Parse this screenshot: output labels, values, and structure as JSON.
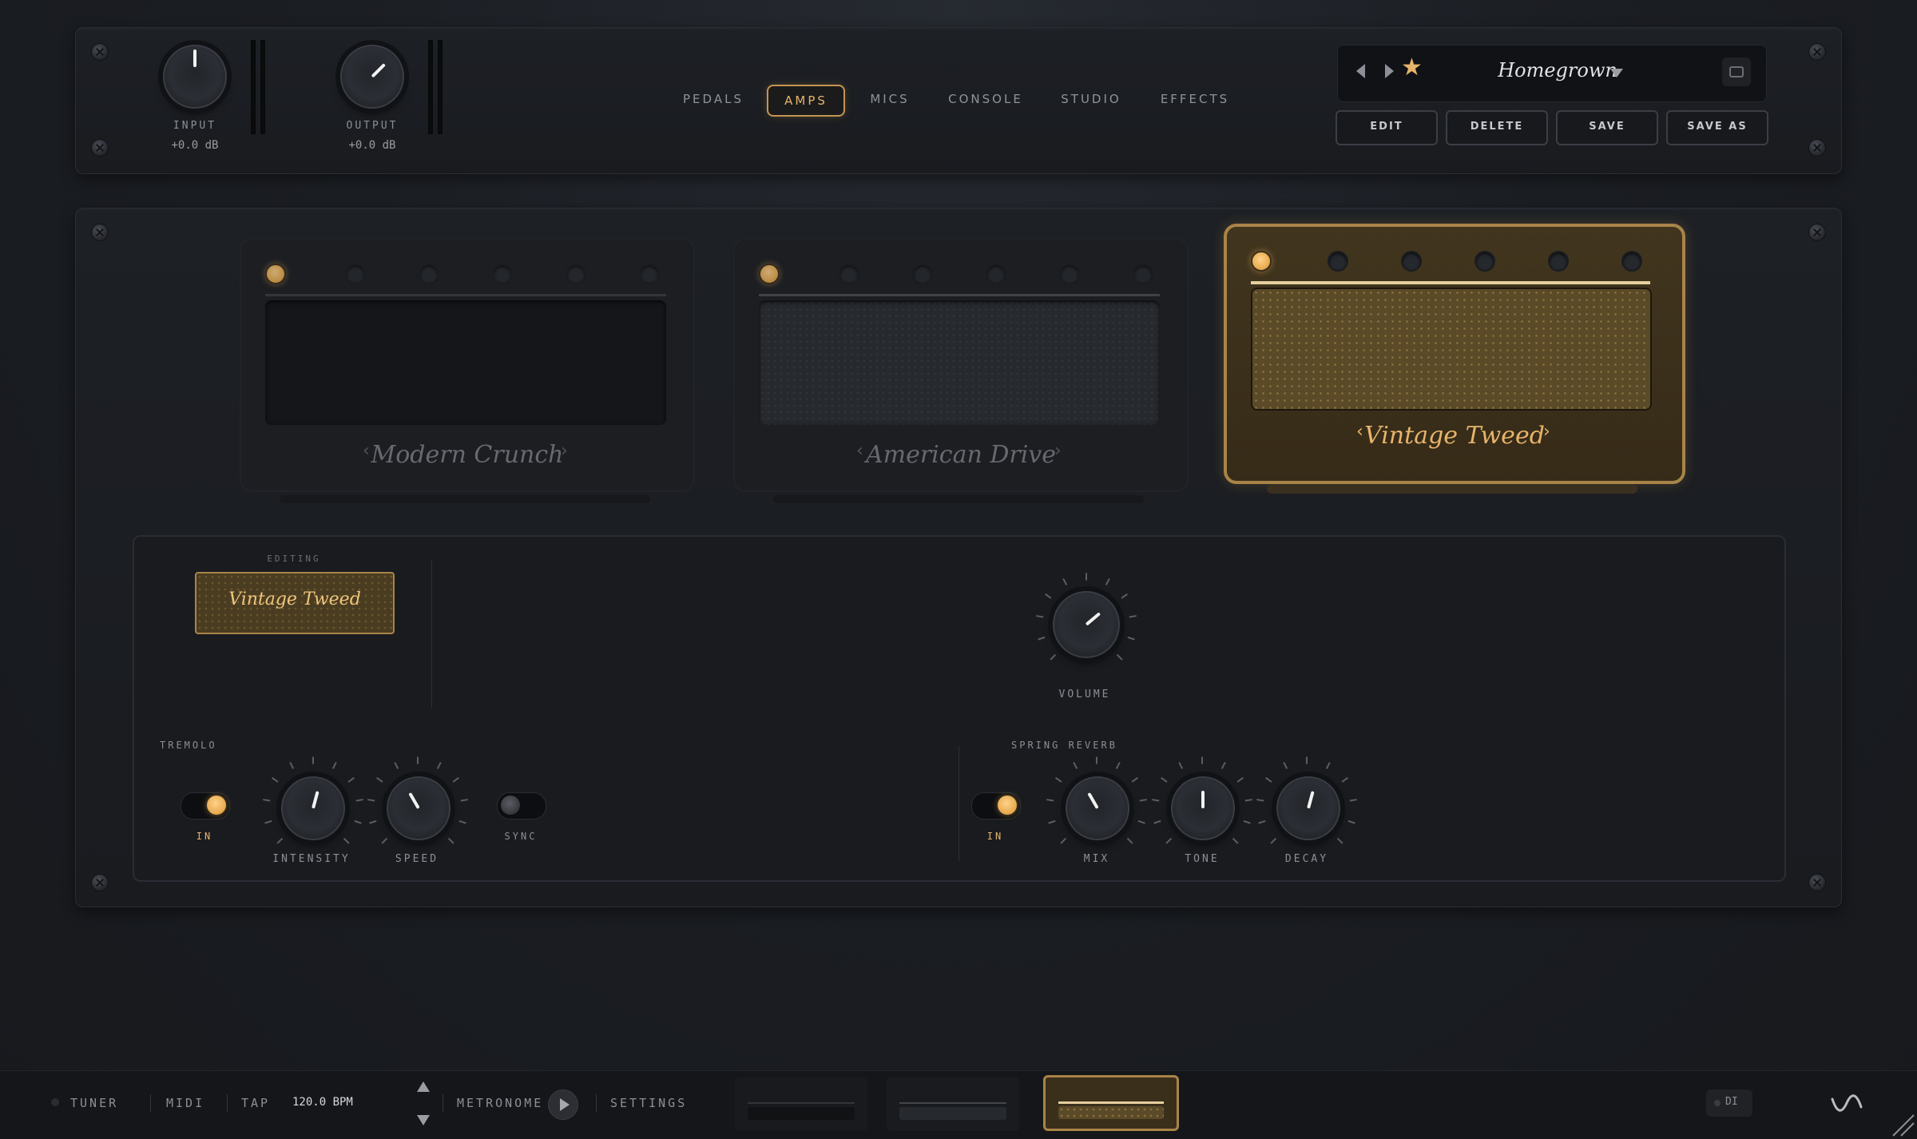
{
  "header": {
    "input": {
      "label": "INPUT",
      "value": "+0.0 dB"
    },
    "output": {
      "label": "OUTPUT",
      "value": "+0.0 dB"
    },
    "tabs": [
      {
        "label": "PEDALS",
        "active": false
      },
      {
        "label": "AMPS",
        "active": true
      },
      {
        "label": "MICS",
        "active": false
      },
      {
        "label": "CONSOLE",
        "active": false
      },
      {
        "label": "STUDIO",
        "active": false
      },
      {
        "label": "EFFECTS",
        "active": false
      }
    ],
    "preset": {
      "name": "Homegrown",
      "favorite": true
    },
    "buttons": {
      "edit": "EDIT",
      "delete": "DELETE",
      "save": "SAVE",
      "save_as": "SAVE AS"
    }
  },
  "amps": [
    {
      "name": "Modern Crunch",
      "selected": false
    },
    {
      "name": "American Drive",
      "selected": false
    },
    {
      "name": "Vintage Tweed",
      "selected": true
    }
  ],
  "editor": {
    "editing_label": "EDITING",
    "editing_name": "Vintage Tweed",
    "volume": {
      "label": "VOLUME"
    },
    "tremolo": {
      "title": "TREMOLO",
      "in_label": "IN",
      "in_on": true,
      "intensity": {
        "label": "INTENSITY"
      },
      "speed": {
        "label": "SPEED"
      },
      "sync_label": "SYNC",
      "sync_on": false
    },
    "spring_reverb": {
      "title": "SPRING REVERB",
      "in_label": "IN",
      "in_on": true,
      "mix": {
        "label": "MIX"
      },
      "tone": {
        "label": "TONE"
      },
      "decay": {
        "label": "DECAY"
      }
    }
  },
  "footer": {
    "tuner": "TUNER",
    "midi": "MIDI",
    "tap": "TAP",
    "bpm": "120.0 BPM",
    "metronome": "METRONOME",
    "settings": "SETTINGS",
    "di": "DI"
  },
  "colors": {
    "accent": "#e7b46b",
    "amp_active": "#3d321c",
    "background": "#1b1e23"
  }
}
